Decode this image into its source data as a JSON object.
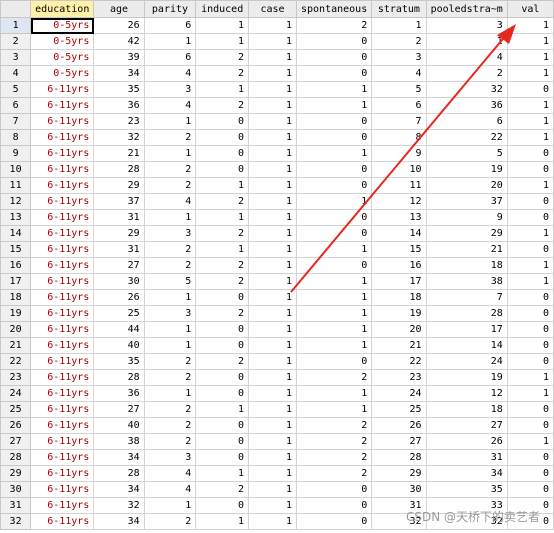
{
  "columns": [
    "education",
    "age",
    "parity",
    "induced",
    "case",
    "spontaneous",
    "stratum",
    "pooledstra~m",
    "val"
  ],
  "rows": [
    [
      "1",
      "0-5yrs",
      "26",
      "6",
      "1",
      "1",
      "2",
      "1",
      "3",
      "1"
    ],
    [
      "2",
      "0-5yrs",
      "42",
      "1",
      "1",
      "1",
      "0",
      "2",
      "1",
      "1"
    ],
    [
      "3",
      "0-5yrs",
      "39",
      "6",
      "2",
      "1",
      "0",
      "3",
      "4",
      "1"
    ],
    [
      "4",
      "0-5yrs",
      "34",
      "4",
      "2",
      "1",
      "0",
      "4",
      "2",
      "1"
    ],
    [
      "5",
      "6-11yrs",
      "35",
      "3",
      "1",
      "1",
      "1",
      "5",
      "32",
      "0"
    ],
    [
      "6",
      "6-11yrs",
      "36",
      "4",
      "2",
      "1",
      "1",
      "6",
      "36",
      "1"
    ],
    [
      "7",
      "6-11yrs",
      "23",
      "1",
      "0",
      "1",
      "0",
      "7",
      "6",
      "1"
    ],
    [
      "8",
      "6-11yrs",
      "32",
      "2",
      "0",
      "1",
      "0",
      "8",
      "22",
      "1"
    ],
    [
      "9",
      "6-11yrs",
      "21",
      "1",
      "0",
      "1",
      "1",
      "9",
      "5",
      "0"
    ],
    [
      "10",
      "6-11yrs",
      "28",
      "2",
      "0",
      "1",
      "0",
      "10",
      "19",
      "0"
    ],
    [
      "11",
      "6-11yrs",
      "29",
      "2",
      "1",
      "1",
      "0",
      "11",
      "20",
      "1"
    ],
    [
      "12",
      "6-11yrs",
      "37",
      "4",
      "2",
      "1",
      "1",
      "12",
      "37",
      "0"
    ],
    [
      "13",
      "6-11yrs",
      "31",
      "1",
      "1",
      "1",
      "0",
      "13",
      "9",
      "0"
    ],
    [
      "14",
      "6-11yrs",
      "29",
      "3",
      "2",
      "1",
      "0",
      "14",
      "29",
      "1"
    ],
    [
      "15",
      "6-11yrs",
      "31",
      "2",
      "1",
      "1",
      "1",
      "15",
      "21",
      "0"
    ],
    [
      "16",
      "6-11yrs",
      "27",
      "2",
      "2",
      "1",
      "0",
      "16",
      "18",
      "1"
    ],
    [
      "17",
      "6-11yrs",
      "30",
      "5",
      "2",
      "1",
      "1",
      "17",
      "38",
      "1"
    ],
    [
      "18",
      "6-11yrs",
      "26",
      "1",
      "0",
      "1",
      "1",
      "18",
      "7",
      "0"
    ],
    [
      "19",
      "6-11yrs",
      "25",
      "3",
      "2",
      "1",
      "1",
      "19",
      "28",
      "0"
    ],
    [
      "20",
      "6-11yrs",
      "44",
      "1",
      "0",
      "1",
      "1",
      "20",
      "17",
      "0"
    ],
    [
      "21",
      "6-11yrs",
      "40",
      "1",
      "0",
      "1",
      "1",
      "21",
      "14",
      "0"
    ],
    [
      "22",
      "6-11yrs",
      "35",
      "2",
      "2",
      "1",
      "0",
      "22",
      "24",
      "0"
    ],
    [
      "23",
      "6-11yrs",
      "28",
      "2",
      "0",
      "1",
      "2",
      "23",
      "19",
      "1"
    ],
    [
      "24",
      "6-11yrs",
      "36",
      "1",
      "0",
      "1",
      "1",
      "24",
      "12",
      "1"
    ],
    [
      "25",
      "6-11yrs",
      "27",
      "2",
      "1",
      "1",
      "1",
      "25",
      "18",
      "0"
    ],
    [
      "26",
      "6-11yrs",
      "40",
      "2",
      "0",
      "1",
      "2",
      "26",
      "27",
      "0"
    ],
    [
      "27",
      "6-11yrs",
      "38",
      "2",
      "0",
      "1",
      "2",
      "27",
      "26",
      "1"
    ],
    [
      "28",
      "6-11yrs",
      "34",
      "3",
      "0",
      "1",
      "2",
      "28",
      "31",
      "0"
    ],
    [
      "29",
      "6-11yrs",
      "28",
      "4",
      "1",
      "1",
      "2",
      "29",
      "34",
      "0"
    ],
    [
      "30",
      "6-11yrs",
      "34",
      "4",
      "2",
      "1",
      "0",
      "30",
      "35",
      "0"
    ],
    [
      "31",
      "6-11yrs",
      "32",
      "1",
      "0",
      "1",
      "0",
      "31",
      "33",
      "0"
    ],
    [
      "32",
      "6-11yrs",
      "34",
      "2",
      "1",
      "1",
      "0",
      "32",
      "32",
      "0"
    ]
  ],
  "watermark": "CSDN @天桥下的卖艺者",
  "colors": {
    "header_bg": "#ececec",
    "active_header": "#fff2a8",
    "edu_text": "#b00000",
    "arrow": "#e8281e"
  }
}
